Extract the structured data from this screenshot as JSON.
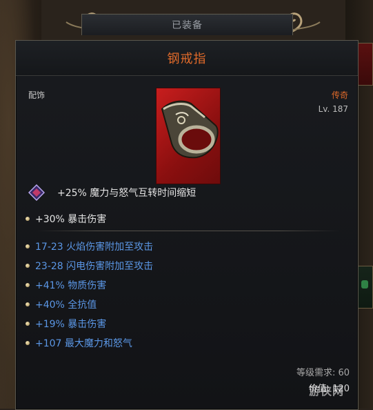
{
  "header": {
    "tab_label": "已装备"
  },
  "item": {
    "name": "钢戒指",
    "category": "配饰",
    "rarity": "传奇",
    "level": "Lv. 187",
    "art_icon": "ring-icon",
    "gem_affix": "+25% 魔力与怒气互转时间缩短",
    "implicit": "+30% 暴击伤害",
    "affixes": [
      "17-23 火焰伤害附加至攻击",
      "23-28 闪电伤害附加至攻击",
      "+41% 物质伤害",
      "+40% 全抗值",
      "+19% 暴击伤害",
      "+107 最大魔力和怒气"
    ],
    "requirement": "等级需求: 60",
    "value": "价值: 120"
  },
  "watermark": "游侠网",
  "colors": {
    "legendary": "#e06a2a",
    "affix_blue": "#5b97e6",
    "art_red": "#c81e1e"
  }
}
